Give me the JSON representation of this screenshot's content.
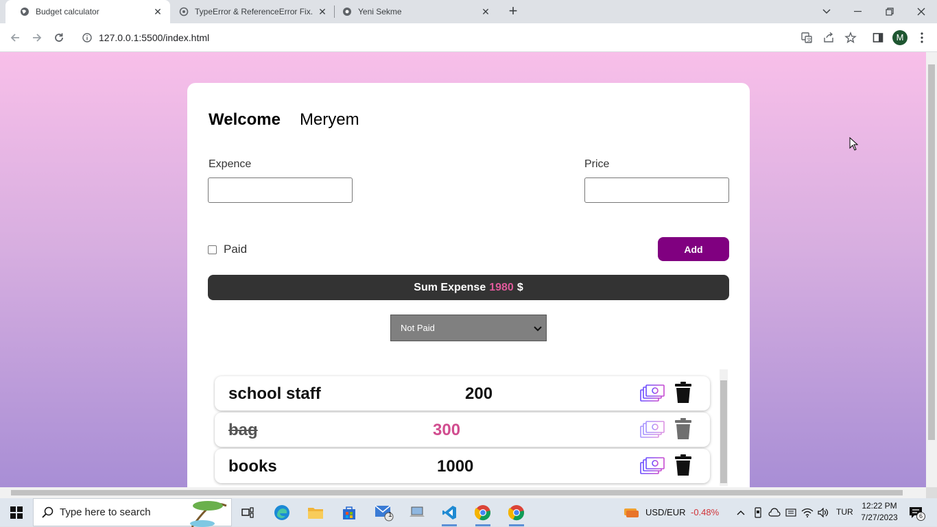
{
  "browser": {
    "tabs": [
      {
        "title": "Budget calculator",
        "active": true
      },
      {
        "title": "TypeError & ReferenceError Fix.",
        "active": false
      },
      {
        "title": "Yeni Sekme",
        "active": false
      }
    ],
    "url": "127.0.0.1:5500/index.html",
    "profile_initial": "M"
  },
  "app": {
    "welcome_label": "Welcome",
    "user_name": "Meryem",
    "expense_label": "Expence",
    "expense_value": "",
    "price_label": "Price",
    "price_value": "",
    "paid_label": "Paid",
    "paid_checked": false,
    "add_label": "Add",
    "sum_label": "Sum Expense",
    "sum_value": "1980",
    "currency": "$",
    "filter_selected": "Not Paid",
    "items": [
      {
        "name": "school staff",
        "price": "200",
        "paid": false
      },
      {
        "name": "bag",
        "price": "300",
        "paid": true
      },
      {
        "name": "books",
        "price": "1000",
        "paid": false
      }
    ],
    "colors": {
      "accent": "#800080",
      "sum_highlight": "#e05a9b",
      "sum_bar": "#333333"
    }
  },
  "taskbar": {
    "search_placeholder": "Type here to search",
    "ticker_label": "USD/EUR",
    "ticker_change": "-0.48%",
    "language": "TUR",
    "time": "12:22 PM",
    "date": "7/27/2023",
    "notification_count": "6",
    "mail_badge": "1"
  }
}
